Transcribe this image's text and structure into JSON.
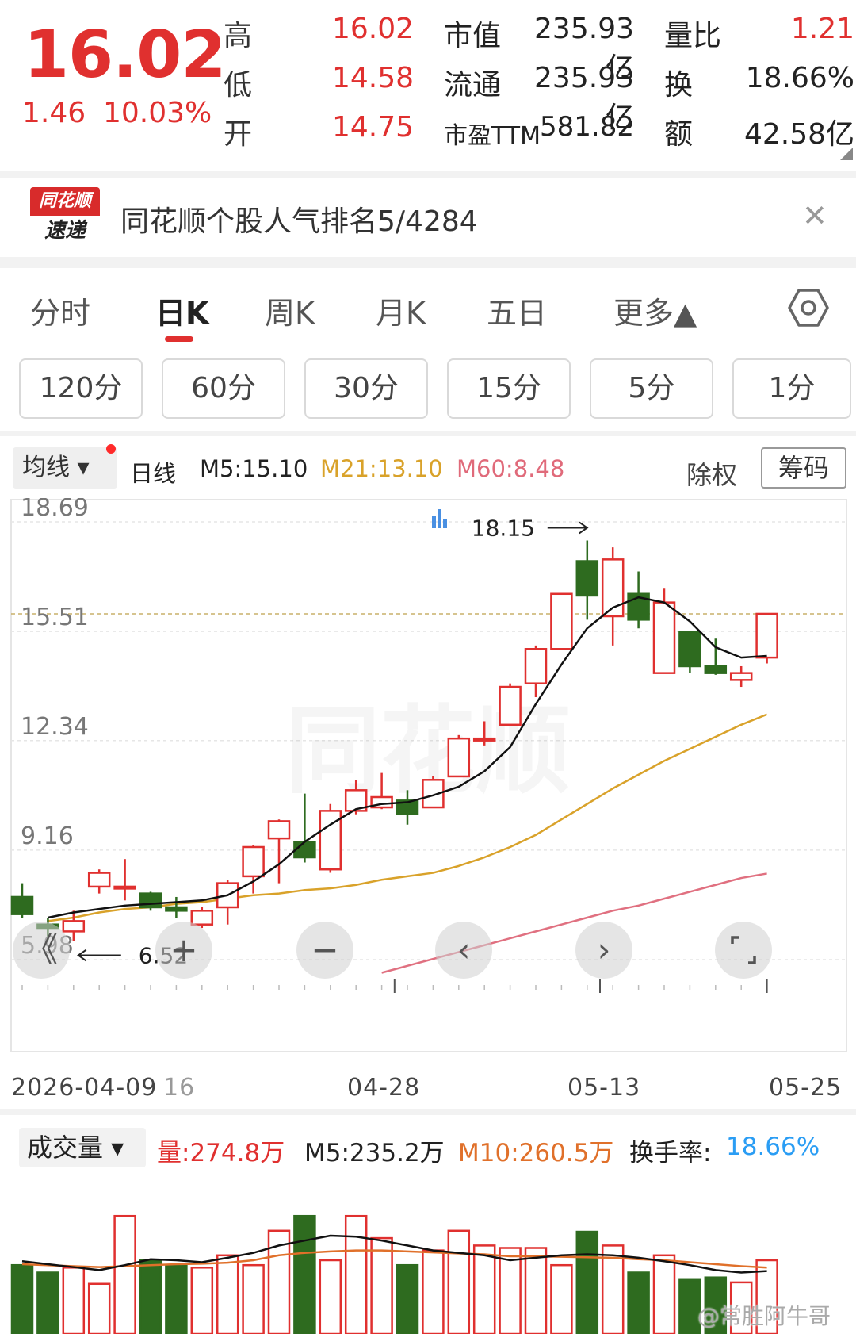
{
  "quote": {
    "price": "16.02",
    "change": "1.46",
    "change_pct": "10.03%",
    "high_label": "高",
    "high": "16.02",
    "low_label": "低",
    "low": "14.58",
    "open_label": "开",
    "open": "14.75",
    "mktcap_label": "市值",
    "mktcap": "235.93亿",
    "float_label": "流通",
    "float": "235.93亿",
    "pe_label": "市盈TTM",
    "pe": "581.82",
    "volratio_label": "量比",
    "volratio": "1.21",
    "turnover_label": "换",
    "turnover": "18.66%",
    "amount_label": "额",
    "amount": "42.58亿"
  },
  "banner": {
    "logo_top": "同花顺",
    "logo_bottom": "速递",
    "text": "同花顺个股人气排名5/4284"
  },
  "tabs": [
    {
      "label": "分时"
    },
    {
      "label": "日K"
    },
    {
      "label": "周K"
    },
    {
      "label": "月K"
    },
    {
      "label": "五日"
    },
    {
      "label": "更多▲"
    }
  ],
  "minute_buttons": [
    "120分",
    "60分",
    "30分",
    "15分",
    "5分",
    "1分"
  ],
  "ma_bar": {
    "selector": "均线 ▾",
    "period": "日线",
    "m5": "M5:15.10",
    "m21": "M21:13.10",
    "m60": "M60:8.48",
    "chuquan": "除权",
    "chouma": "筹码"
  },
  "colors": {
    "up": "#e0302f",
    "down": "#2e6b1f",
    "m5": "#111111",
    "m21": "#d9a22a",
    "m60": "#e07080",
    "accent_blue": "#2a9df4"
  },
  "chart_data": [
    {
      "type": "candlestick",
      "y_ticks": [
        "18.69",
        "15.51",
        "12.34",
        "9.16",
        "5.98"
      ],
      "ylim": [
        5.98,
        18.69
      ],
      "x_labels": [
        "2026-04-09",
        "16",
        "04-28",
        "05-13",
        "05-25"
      ],
      "annotations": {
        "max": "18.15",
        "min": "6.52"
      },
      "candles": [
        {
          "o": 7.8,
          "c": 7.3,
          "h": 8.2,
          "l": 7.2
        },
        {
          "o": 7.0,
          "c": 6.9,
          "h": 7.2,
          "l": 6.55
        },
        {
          "o": 6.8,
          "c": 7.1,
          "h": 7.4,
          "l": 6.52
        },
        {
          "o": 8.1,
          "c": 8.5,
          "h": 8.6,
          "l": 7.9
        },
        {
          "o": 8.1,
          "c": 8.1,
          "h": 8.9,
          "l": 7.7
        },
        {
          "o": 7.9,
          "c": 7.5,
          "h": 7.95,
          "l": 7.4
        },
        {
          "o": 7.5,
          "c": 7.4,
          "h": 7.8,
          "l": 7.2
        },
        {
          "o": 7.0,
          "c": 7.4,
          "h": 7.5,
          "l": 6.9
        },
        {
          "o": 7.5,
          "c": 8.2,
          "h": 8.3,
          "l": 7.0
        },
        {
          "o": 8.4,
          "c": 9.25,
          "h": 9.3,
          "l": 7.9
        },
        {
          "o": 9.5,
          "c": 10.0,
          "h": 10.05,
          "l": 8.2
        },
        {
          "o": 9.4,
          "c": 8.95,
          "h": 10.8,
          "l": 8.8
        },
        {
          "o": 8.6,
          "c": 10.3,
          "h": 10.5,
          "l": 8.5
        },
        {
          "o": 10.3,
          "c": 10.9,
          "h": 11.2,
          "l": 10.2
        },
        {
          "o": 10.4,
          "c": 10.7,
          "h": 11.4,
          "l": 10.35
        },
        {
          "o": 10.6,
          "c": 10.2,
          "h": 10.9,
          "l": 9.9
        },
        {
          "o": 10.4,
          "c": 11.2,
          "h": 11.3,
          "l": 10.4
        },
        {
          "o": 11.3,
          "c": 12.4,
          "h": 12.5,
          "l": 11.3
        },
        {
          "o": 12.4,
          "c": 12.4,
          "h": 12.9,
          "l": 12.2
        },
        {
          "o": 12.8,
          "c": 13.9,
          "h": 14.0,
          "l": 12.8
        },
        {
          "o": 14.0,
          "c": 15.0,
          "h": 15.1,
          "l": 13.6
        },
        {
          "o": 15.0,
          "c": 16.6,
          "h": 16.6,
          "l": 15.0
        },
        {
          "o": 17.55,
          "c": 16.55,
          "h": 18.15,
          "l": 15.85
        },
        {
          "o": 15.95,
          "c": 17.6,
          "h": 17.95,
          "l": 15.1
        },
        {
          "o": 16.6,
          "c": 15.85,
          "h": 17.25,
          "l": 15.6
        },
        {
          "o": 14.3,
          "c": 16.35,
          "h": 16.75,
          "l": 14.3
        },
        {
          "o": 15.5,
          "c": 14.5,
          "h": 15.5,
          "l": 14.3
        },
        {
          "o": 14.5,
          "c": 14.3,
          "h": 15.3,
          "l": 14.25
        },
        {
          "o": 14.1,
          "c": 14.3,
          "h": 14.5,
          "l": 13.9
        },
        {
          "o": 14.75,
          "c": 16.02,
          "h": 16.02,
          "l": 14.58
        }
      ],
      "ma5": [
        7.2,
        7.35,
        7.45,
        7.55,
        7.6,
        7.65,
        7.7,
        7.85,
        8.25,
        8.75,
        9.4,
        9.9,
        10.35,
        10.5,
        10.55,
        10.75,
        11.0,
        11.45,
        12.15,
        13.4,
        14.55,
        15.6,
        16.2,
        16.5,
        16.35,
        15.8,
        15.05,
        14.75,
        14.8
      ],
      "ma21": [
        7.1,
        7.2,
        7.35,
        7.45,
        7.5,
        7.6,
        7.65,
        7.75,
        7.85,
        7.9,
        8.0,
        8.05,
        8.15,
        8.3,
        8.4,
        8.5,
        8.7,
        8.95,
        9.25,
        9.6,
        10.05,
        10.5,
        10.95,
        11.35,
        11.75,
        12.1,
        12.45,
        12.8,
        13.1
      ],
      "ma60": [
        5.6,
        5.8,
        6.0,
        6.2,
        6.4,
        6.6,
        6.8,
        7.0,
        7.2,
        7.4,
        7.55,
        7.75,
        7.95,
        8.15,
        8.35,
        8.48
      ]
    },
    {
      "type": "bar",
      "title": "成交量",
      "values_wan": [
        140,
        125,
        135,
        102,
        240,
        150,
        140,
        135,
        160,
        140,
        210,
        240,
        150,
        240,
        195,
        140,
        170,
        210,
        180,
        175,
        175,
        140,
        208,
        180,
        125,
        160,
        110,
        115,
        105,
        150
      ],
      "ma5": [
        148,
        142,
        136,
        130,
        140,
        152,
        150,
        146,
        155,
        165,
        180,
        190,
        200,
        198,
        190,
        180,
        170,
        165,
        160,
        150,
        155,
        160,
        162,
        160,
        155,
        148,
        140,
        130,
        125,
        128
      ],
      "ma10": [
        142,
        140,
        138,
        136,
        138,
        140,
        142,
        143,
        145,
        150,
        160,
        165,
        168,
        170,
        170,
        168,
        166,
        164,
        162,
        158,
        158,
        157,
        156,
        155,
        152,
        150,
        146,
        142,
        138,
        135
      ]
    }
  ],
  "overlay": {
    "zoom_out_icon": "《",
    "zoom_in_icon": "+",
    "minus_icon": "−",
    "prev_icon": "‹",
    "next_icon": "›"
  },
  "volume_bar": {
    "selector": "成交量 ▾",
    "vol": "量:274.8万",
    "m5": "M5:235.2万",
    "m10": "M10:260.5万",
    "turnover_label": "换手率:",
    "turnover": "18.66%"
  },
  "watermark": "@常胜阿牛哥"
}
